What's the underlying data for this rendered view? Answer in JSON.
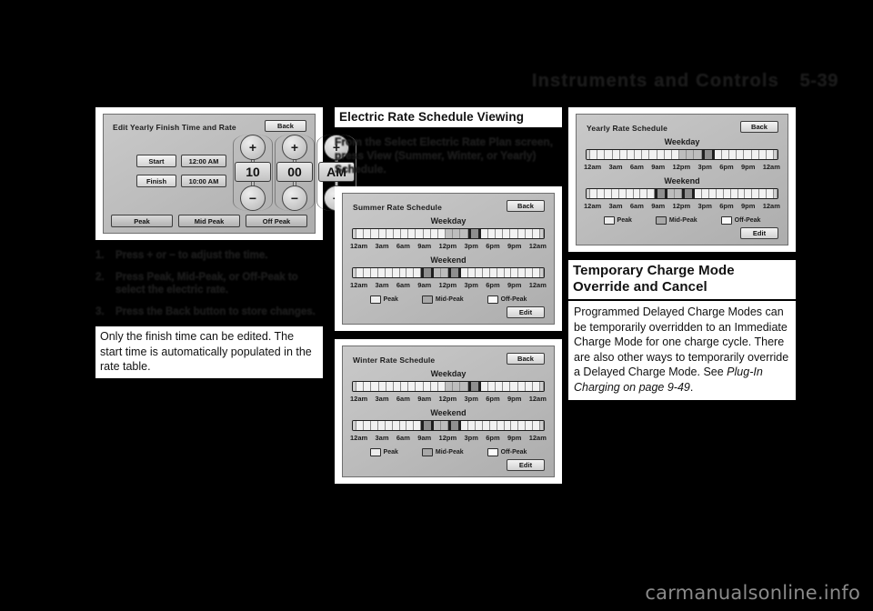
{
  "header": {
    "title": "Instruments and Controls",
    "page_number": "5-39"
  },
  "watermark": "carmanualsonline.info",
  "left_column": {
    "edit_screen": {
      "title": "Edit Yearly Finish Time and Rate",
      "back_label": "Back",
      "start_label": "Start",
      "start_value": "12:00 AM",
      "finish_label": "Finish",
      "finish_value": "10:00 AM",
      "spinners": [
        {
          "name": "hour",
          "plus": "+",
          "value": "10",
          "minus": "−"
        },
        {
          "name": "minute",
          "plus": "+",
          "value": "00",
          "minus": "−"
        },
        {
          "name": "meridiem",
          "plus": "+",
          "value": "AM",
          "minus": "−"
        }
      ],
      "rate_buttons": [
        "Peak",
        "Mid Peak",
        "Off Peak"
      ]
    },
    "steps": [
      {
        "num": "1.",
        "text": "Press + or − to adjust the time."
      },
      {
        "num": "2.",
        "text": "Press Peak, Mid-Peak, or Off-Peak to select the electric rate."
      },
      {
        "num": "3.",
        "text": "Press the Back button to store changes."
      }
    ],
    "note": "Only the finish time can be edited. The start time is automatically populated in the rate table."
  },
  "middle_column": {
    "heading": "Electric Rate Schedule Viewing",
    "intro": "From the Select Electric Rate Plan screen, press View (Summer, Winter, or Yearly) Schedule.",
    "schedules": [
      {
        "id": "summer",
        "title": "Summer Rate Schedule",
        "back_label": "Back",
        "edit_label": "Edit",
        "weekday_label": "Weekday",
        "weekend_label": "Weekend",
        "ticks": [
          "12am",
          "3am",
          "6am",
          "9am",
          "12pm",
          "3pm",
          "6pm",
          "9pm",
          "12am"
        ],
        "legend": [
          {
            "key": "peak",
            "label": "Peak"
          },
          {
            "key": "mid",
            "label": "Mid-Peak"
          },
          {
            "key": "off",
            "label": "Off-Peak"
          }
        ],
        "weekday_cells": [
          "off",
          "off",
          "off",
          "off",
          "off",
          "off",
          "off",
          "off",
          "off",
          "off",
          "off",
          "off",
          "mid",
          "mid",
          "mid",
          "peak",
          "off",
          "off",
          "off",
          "off",
          "off",
          "off",
          "off",
          "off"
        ],
        "weekend_cells": [
          "off",
          "off",
          "off",
          "off",
          "off",
          "off",
          "off",
          "off",
          "off",
          "peak",
          "mid",
          "mid",
          "peak",
          "off",
          "off",
          "off",
          "off",
          "off",
          "off",
          "off",
          "off",
          "off",
          "off",
          "off"
        ]
      },
      {
        "id": "winter",
        "title": "Winter Rate Schedule",
        "back_label": "Back",
        "edit_label": "Edit",
        "weekday_label": "Weekday",
        "weekend_label": "Weekend",
        "ticks": [
          "12am",
          "3am",
          "6am",
          "9am",
          "12pm",
          "3pm",
          "6pm",
          "9pm",
          "12am"
        ],
        "legend": [
          {
            "key": "peak",
            "label": "Peak"
          },
          {
            "key": "mid",
            "label": "Mid-Peak"
          },
          {
            "key": "off",
            "label": "Off-Peak"
          }
        ],
        "weekday_cells": [
          "off",
          "off",
          "off",
          "off",
          "off",
          "off",
          "off",
          "off",
          "off",
          "off",
          "off",
          "off",
          "mid",
          "mid",
          "mid",
          "peak",
          "off",
          "off",
          "off",
          "off",
          "off",
          "off",
          "off",
          "off"
        ],
        "weekend_cells": [
          "off",
          "off",
          "off",
          "off",
          "off",
          "off",
          "off",
          "off",
          "off",
          "peak",
          "mid",
          "mid",
          "peak",
          "off",
          "off",
          "off",
          "off",
          "off",
          "off",
          "off",
          "off",
          "off",
          "off",
          "off"
        ]
      }
    ]
  },
  "right_column": {
    "yearly_schedule": {
      "id": "yearly",
      "title": "Yearly Rate Schedule",
      "back_label": "Back",
      "edit_label": "Edit",
      "weekday_label": "Weekday",
      "weekend_label": "Weekend",
      "ticks": [
        "12am",
        "3am",
        "6am",
        "9am",
        "12pm",
        "3pm",
        "6pm",
        "9pm",
        "12am"
      ],
      "legend": [
        {
          "key": "peak",
          "label": "Peak"
        },
        {
          "key": "mid",
          "label": "Mid-Peak"
        },
        {
          "key": "off",
          "label": "Off-Peak"
        }
      ],
      "weekday_cells": [
        "off",
        "off",
        "off",
        "off",
        "off",
        "off",
        "off",
        "off",
        "off",
        "off",
        "off",
        "off",
        "mid",
        "mid",
        "mid",
        "peak",
        "off",
        "off",
        "off",
        "off",
        "off",
        "off",
        "off",
        "off"
      ],
      "weekend_cells": [
        "off",
        "off",
        "off",
        "off",
        "off",
        "off",
        "off",
        "off",
        "off",
        "peak",
        "mid",
        "mid",
        "peak",
        "off",
        "off",
        "off",
        "off",
        "off",
        "off",
        "off",
        "off",
        "off",
        "off",
        "off"
      ]
    },
    "heading_line1": "Temporary Charge Mode",
    "heading_line2": "Override and Cancel",
    "body_text": "Programmed Delayed Charge Modes can be temporarily overridden to an Immediate Charge Mode for one charge cycle. There are also other ways to temporarily override a Delayed Charge Mode. See ",
    "body_reference": "Plug-In Charging on page 9-49",
    "body_end": "."
  }
}
